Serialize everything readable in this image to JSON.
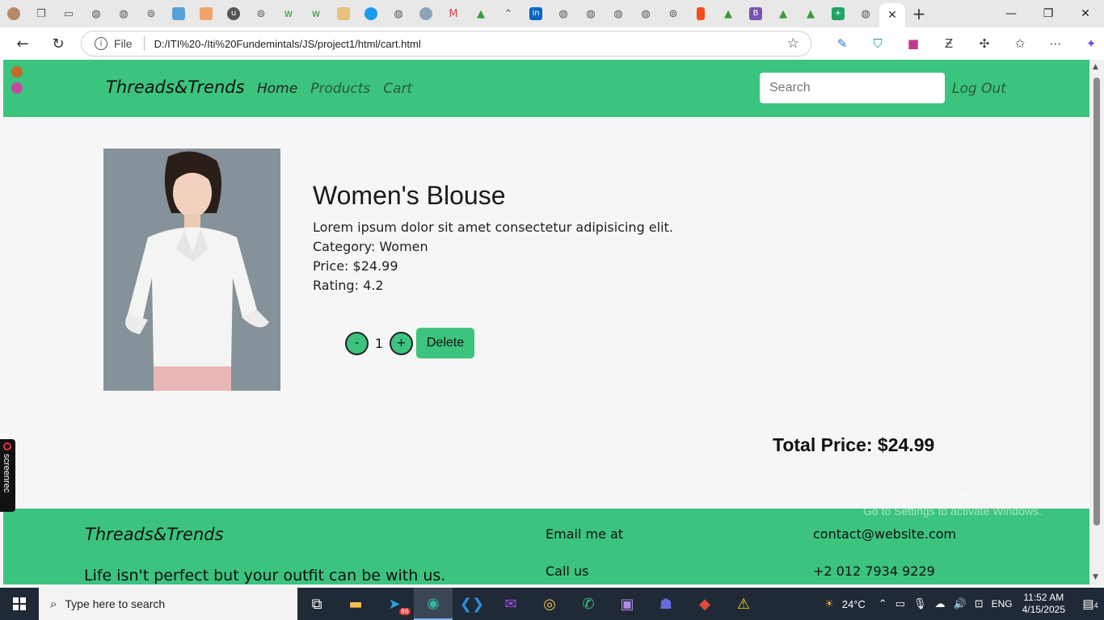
{
  "browser": {
    "tab_icons": [
      "profile",
      "workspaces",
      "tab-actions",
      "globe",
      "globe",
      "settings",
      "pic",
      "figma-like",
      "upwork",
      "settings",
      "wix",
      "wix",
      "slides",
      "sky",
      "globe",
      "photo",
      "gmail",
      "drive",
      "chevrons",
      "linkedin",
      "globe",
      "globe",
      "globe",
      "globe",
      "settings",
      "figma",
      "drive",
      "bootstrap",
      "drive",
      "drive",
      "sheets"
    ],
    "active_tab_close": "✕",
    "new_tab": "+",
    "address": {
      "file_label": "File",
      "url": "D:/ITI%20-/Iti%20Fundemintals/JS/project1/html/cart.html"
    }
  },
  "site": {
    "brand": "Threads&Trends",
    "nav": {
      "home": "Home",
      "products": "Products",
      "cart": "Cart"
    },
    "search_placeholder": "Search",
    "logout": "Log Out"
  },
  "cart": {
    "item": {
      "title": "Women's Blouse",
      "description": "Lorem ipsum dolor sit amet consectetur adipisicing elit.",
      "category": "Category: Women",
      "price": "Price: $24.99",
      "rating": "Rating: 4.2",
      "quantity": "1",
      "minus": "-",
      "plus": "+",
      "delete_label": "Delete"
    },
    "total": "Total Price: $24.99"
  },
  "footer": {
    "brand": "Threads&Trends",
    "tagline": "Life isn't perfect but your outfit can be with us.",
    "email_label": "Email me at",
    "call_label": "Call us",
    "email": "contact@website.com",
    "phone": "+2 012 7934 9229"
  },
  "overlay": {
    "activate_line1": "Activate Windows",
    "activate_line2": "Go to Settings to activate Windows.",
    "screenrec": "screenrec"
  },
  "taskbar": {
    "search_placeholder": "Type here to search",
    "temperature": "24°C",
    "language": "ENG",
    "time": "11:52 AM",
    "date": "4/15/2025",
    "notifications": "4",
    "telegram_badge": "86"
  },
  "colors": {
    "brand_green": "#3cc37e",
    "page_bg": "#f6f6f6",
    "taskbar": "#202a36"
  }
}
